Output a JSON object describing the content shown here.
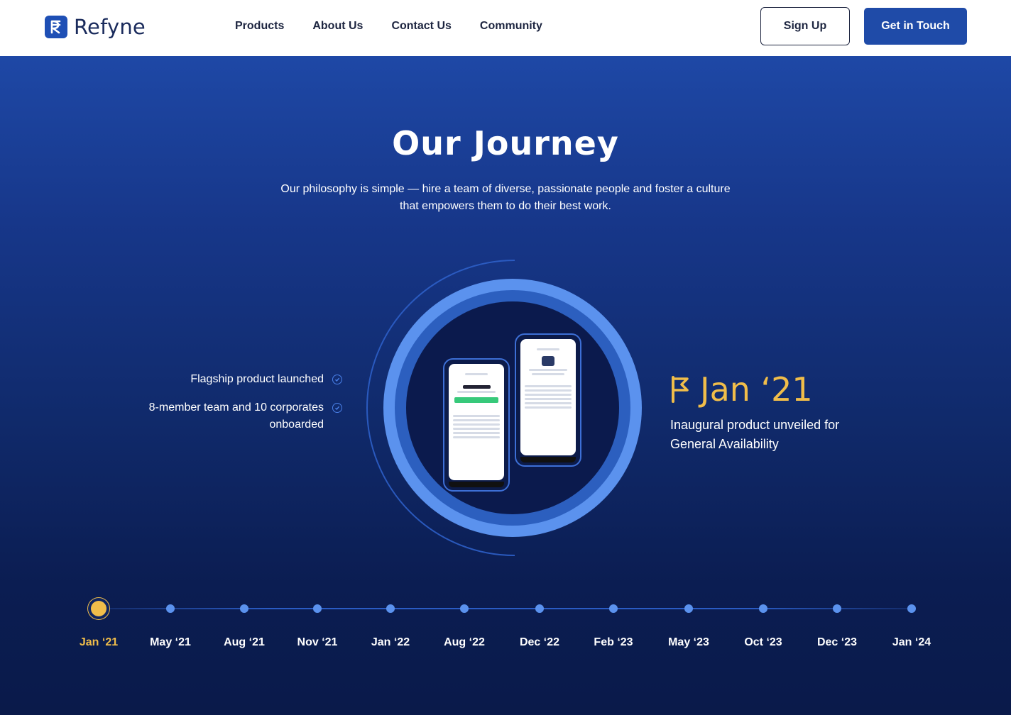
{
  "header": {
    "brand": "Refyne",
    "nav": [
      "Products",
      "About Us",
      "Contact Us",
      "Community"
    ],
    "signup_label": "Sign Up",
    "cta_label": "Get in Touch"
  },
  "hero": {
    "title": "Our Journey",
    "subtitle": "Our philosophy is simple — hire a team of diverse, passionate people and foster a culture that empowers them to do their best work."
  },
  "achievements": [
    "Flagship product launched",
    "8-member team and 10 corporates onboarded"
  ],
  "milestone": {
    "date": "Jan ‘21",
    "description": "Inaugural product unveiled for General Availability"
  },
  "timeline": {
    "active_index": 0,
    "labels": [
      "Jan ‘21",
      "May ‘21",
      "Aug ‘21",
      "Nov ‘21",
      "Jan ‘22",
      "Aug ‘22",
      "Dec ‘22",
      "Feb ‘23",
      "May ‘23",
      "Oct ‘23",
      "Dec ‘23",
      "Jan ‘24"
    ]
  },
  "colors": {
    "brand": "#1f4ba8",
    "accent": "#f0bd4a",
    "dot": "#5b92ee"
  }
}
